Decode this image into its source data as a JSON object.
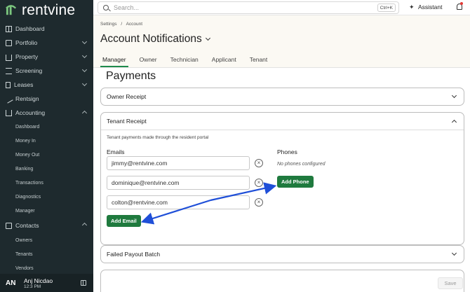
{
  "brand": {
    "name": "rentvine"
  },
  "sidebar": {
    "items": [
      {
        "label": "Dashboard",
        "icon": "grid-icon"
      },
      {
        "label": "Portfolio",
        "icon": "briefcase-icon",
        "expandable": true
      },
      {
        "label": "Property",
        "icon": "home-icon",
        "expandable": true
      },
      {
        "label": "Screening",
        "icon": "filter-icon",
        "expandable": true
      },
      {
        "label": "Leases",
        "icon": "document-icon",
        "expandable": true
      },
      {
        "label": "Rentsign",
        "icon": "pen-icon"
      },
      {
        "label": "Accounting",
        "icon": "bank-icon",
        "expanded": true
      }
    ],
    "accounting_sub": [
      "Dashboard",
      "Money In",
      "Money Out",
      "Banking",
      "Transactions",
      "Diagnostics",
      "Manager"
    ],
    "contacts": {
      "label": "Contacts",
      "icon": "contacts-icon"
    },
    "contacts_sub": [
      "Owners",
      "Tenants",
      "Vendors"
    ],
    "user": {
      "initials": "AN",
      "name": "Anj Nicdao",
      "time": "12:3 PM"
    }
  },
  "topbar": {
    "search_placeholder": "Search...",
    "shortcut": "Ctrl+K",
    "assistant_label": "Assistant"
  },
  "header": {
    "breadcrumbs": [
      "Settings",
      "/",
      "Account"
    ],
    "title": "Account Notifications",
    "tabs": [
      "Manager",
      "Owner",
      "Technician",
      "Applicant",
      "Tenant"
    ],
    "active_tab": "Manager"
  },
  "content": {
    "section_title": "Payments",
    "owner_receipt": "Owner Receipt",
    "tenant_receipt": {
      "title": "Tenant Receipt",
      "description": "Tenant payments made through the resident portal",
      "emails_label": "Emails",
      "emails": [
        "jimmy@rentvine.com",
        "dominique@rentvine.com",
        "colton@rentvine.com"
      ],
      "add_email": "Add Email",
      "phones_label": "Phones",
      "no_phones": "No phones configured",
      "add_phone": "Add Phone"
    },
    "failed_payout": "Failed Payout Batch",
    "save_label": "Save"
  },
  "colors": {
    "sidebar_bg": "#1e2a2e",
    "accent_green": "#1f7a3e",
    "annotation_blue": "#1f4fd8"
  }
}
